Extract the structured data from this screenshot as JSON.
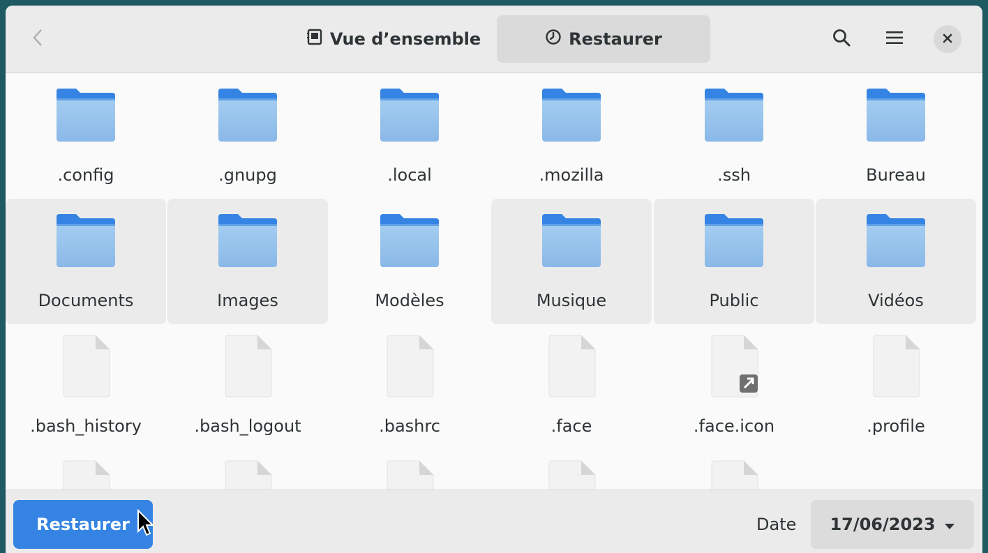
{
  "header": {
    "back_icon": "chevron-left-icon",
    "tabs": [
      {
        "label": "Vue d’ensemble",
        "icon": "overview-icon",
        "active": false
      },
      {
        "label": "Restaurer",
        "icon": "clock-icon",
        "active": true
      }
    ],
    "search_icon": "search-icon",
    "menu_icon": "hamburger-menu-icon",
    "close_icon": "close-icon"
  },
  "files": [
    {
      "name": ".config",
      "type": "folder",
      "selected": false
    },
    {
      "name": ".gnupg",
      "type": "folder",
      "selected": false
    },
    {
      "name": ".local",
      "type": "folder",
      "selected": false
    },
    {
      "name": ".mozilla",
      "type": "folder",
      "selected": false
    },
    {
      "name": ".ssh",
      "type": "folder",
      "selected": false
    },
    {
      "name": "Bureau",
      "type": "folder",
      "selected": false
    },
    {
      "name": "Documents",
      "type": "folder",
      "selected": true
    },
    {
      "name": "Images",
      "type": "folder",
      "selected": true
    },
    {
      "name": "Modèles",
      "type": "folder",
      "selected": false
    },
    {
      "name": "Musique",
      "type": "folder",
      "selected": true
    },
    {
      "name": "Public",
      "type": "folder",
      "selected": true
    },
    {
      "name": "Vidéos",
      "type": "folder",
      "selected": true
    },
    {
      "name": ".bash_history",
      "type": "file",
      "selected": false
    },
    {
      "name": ".bash_logout",
      "type": "file",
      "selected": false
    },
    {
      "name": ".bashrc",
      "type": "file",
      "selected": false
    },
    {
      "name": ".face",
      "type": "file",
      "selected": false
    },
    {
      "name": ".face.icon",
      "type": "symlink",
      "selected": false
    },
    {
      "name": ".profile",
      "type": "file",
      "selected": false
    },
    {
      "name": "",
      "type": "file",
      "selected": false
    },
    {
      "name": "",
      "type": "file",
      "selected": false
    },
    {
      "name": "",
      "type": "file",
      "selected": false
    },
    {
      "name": "",
      "type": "file",
      "selected": false
    },
    {
      "name": "",
      "type": "file",
      "selected": false
    }
  ],
  "footer": {
    "restore_label": "Restaurer",
    "date_label": "Date",
    "date_value": "17/06/2023"
  },
  "colors": {
    "accent": "#3584e4",
    "folder_tab": "#3584e4",
    "folder_body_top": "#a4cdf0",
    "folder_body_bottom": "#8ab8e8",
    "selection": "#ebebeb"
  }
}
